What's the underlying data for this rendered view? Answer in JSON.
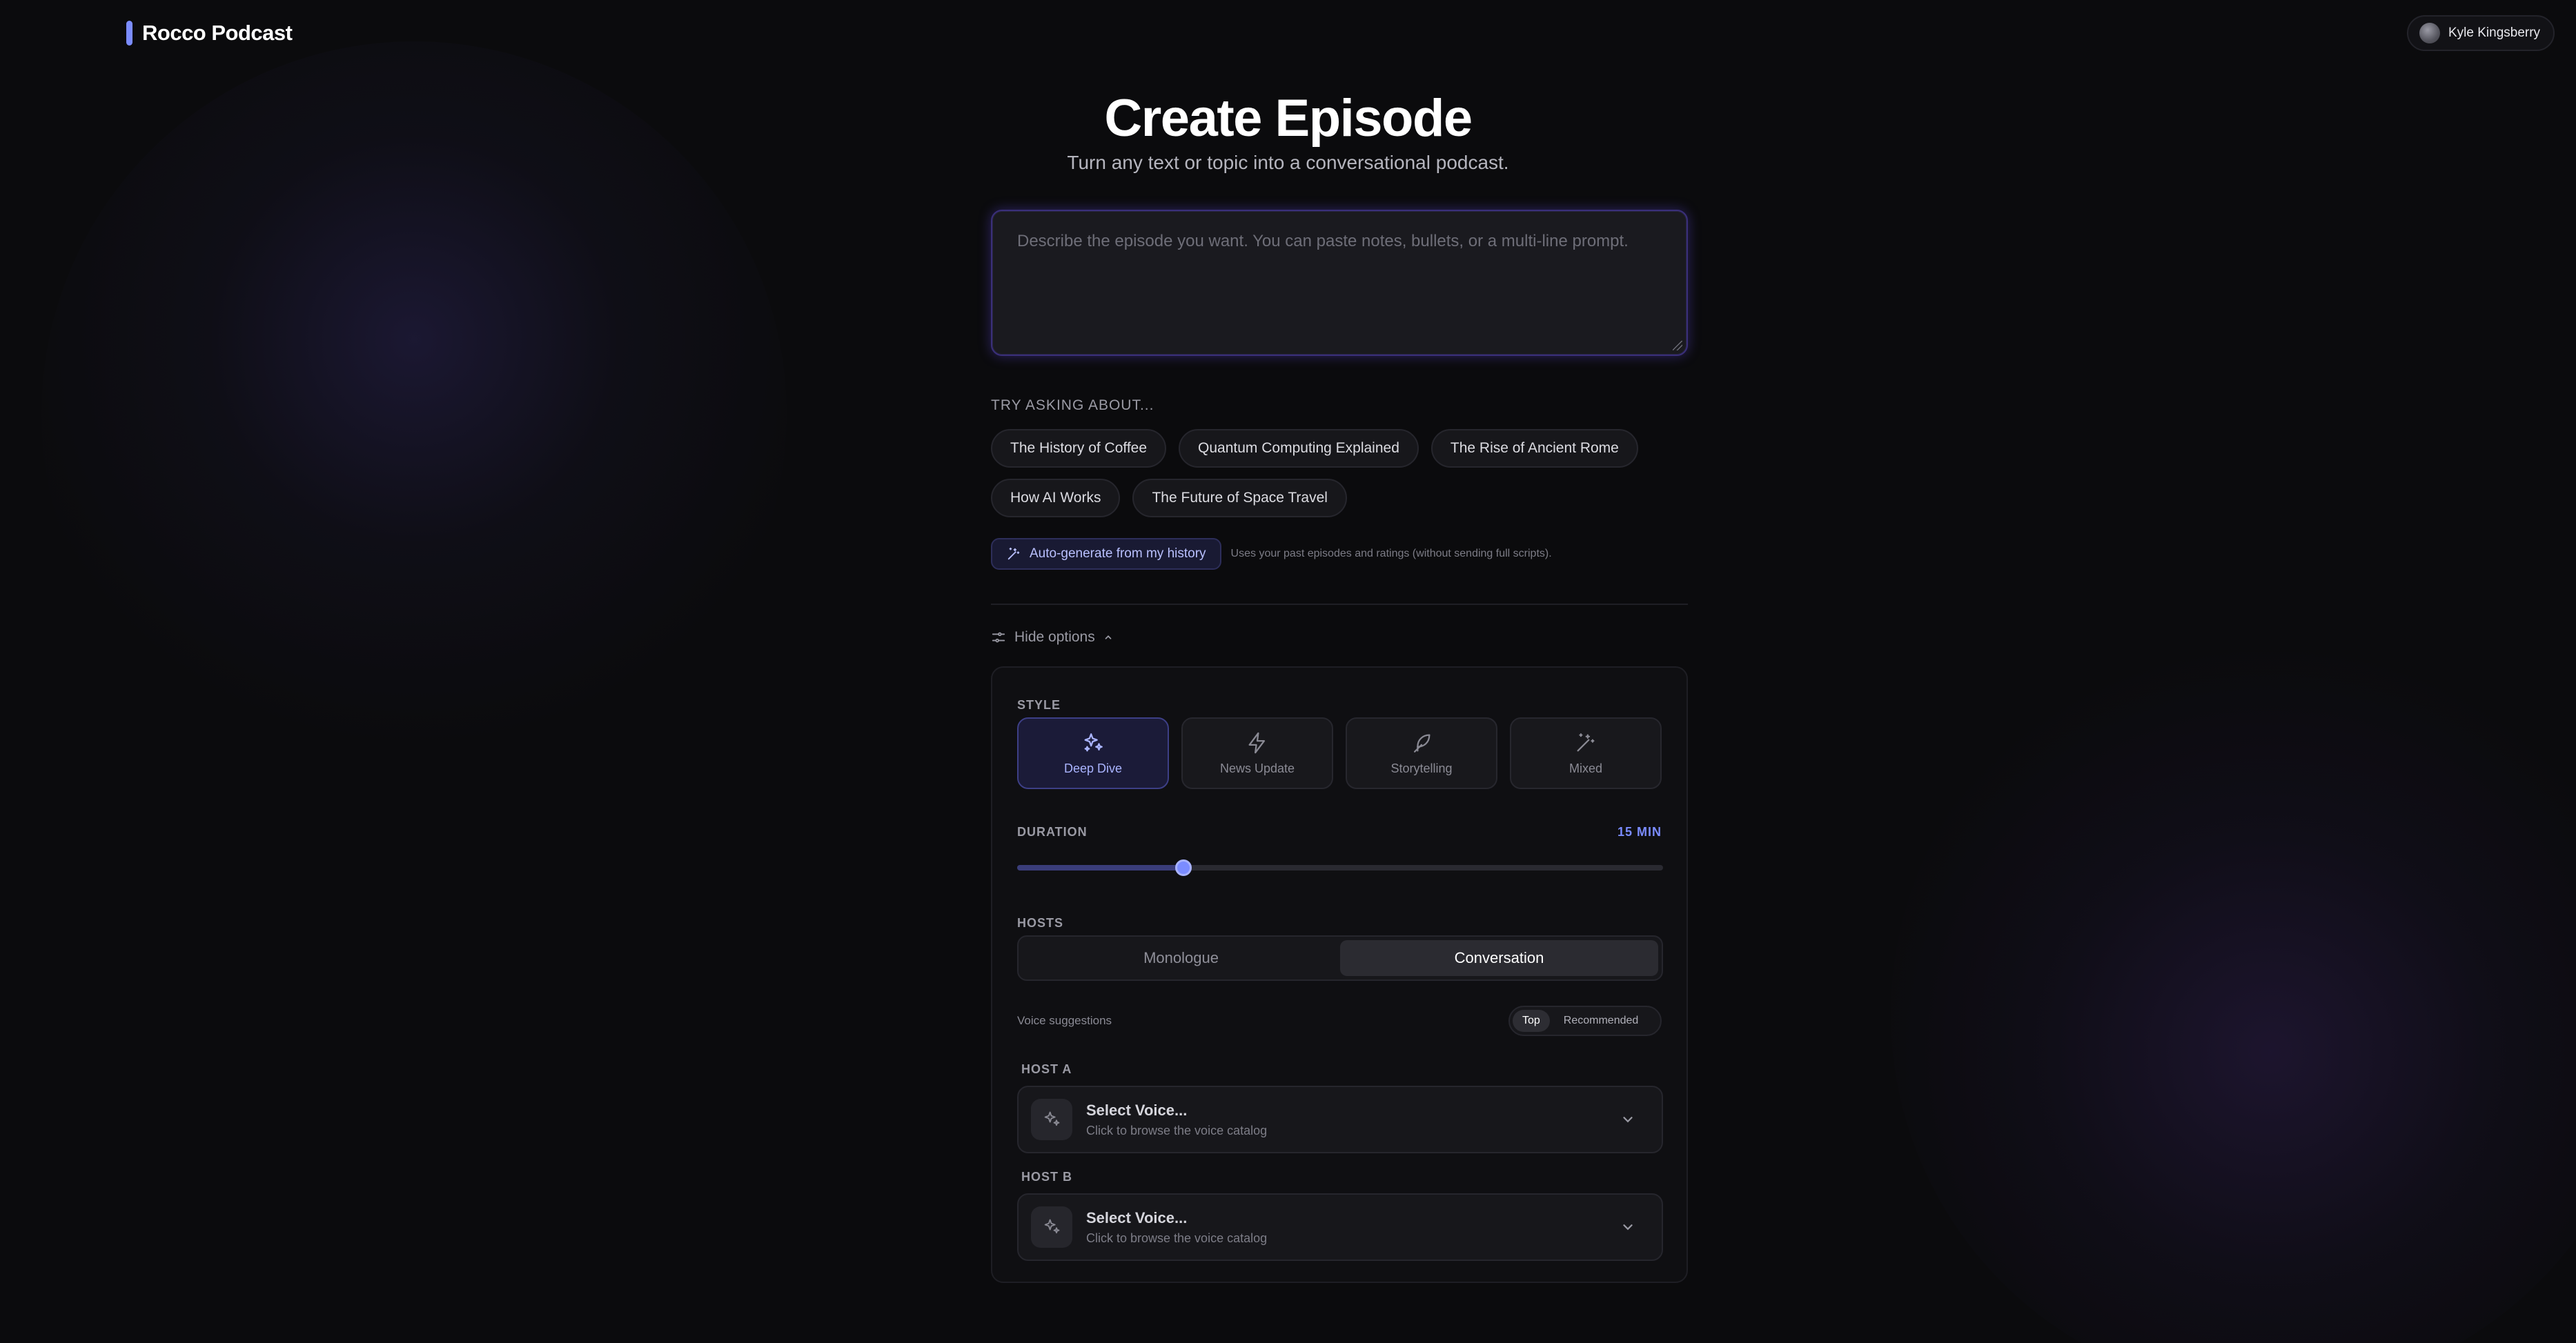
{
  "header": {
    "brand": "Rocco Podcast",
    "user_name": "Kyle Kingsberry"
  },
  "hero": {
    "title": "Create Episode",
    "subtitle": "Turn any text or topic into a conversational podcast."
  },
  "prompt": {
    "placeholder": "Describe the episode you want. You can paste notes, bullets, or a multi-line prompt.",
    "value": ""
  },
  "suggestions": {
    "label": "TRY ASKING ABOUT...",
    "items": [
      "The History of Coffee",
      "Quantum Computing Explained",
      "The Rise of Ancient Rome",
      "How AI Works",
      "The Future of Space Travel"
    ]
  },
  "autogen": {
    "button": "Auto-generate from my history",
    "note": "Uses your past episodes and ratings (without sending full scripts)."
  },
  "options": {
    "toggle_label": "Hide options",
    "style": {
      "label": "STYLE",
      "items": [
        "Deep Dive",
        "News Update",
        "Storytelling",
        "Mixed"
      ],
      "selected": "Deep Dive"
    },
    "duration": {
      "label": "DURATION",
      "value_label": "15 MIN",
      "fraction": 0.257
    },
    "hosts": {
      "label": "HOSTS",
      "modes": [
        "Monologue",
        "Conversation"
      ],
      "selected": "Conversation"
    },
    "voice_suggestions": {
      "label": "Voice suggestions",
      "modes": [
        "Top",
        "Recommended"
      ],
      "selected": "Top"
    },
    "host_a": {
      "label": "HOST A",
      "title": "Select Voice...",
      "subtitle": "Click to browse the voice catalog"
    },
    "host_b": {
      "label": "HOST B",
      "title": "Select Voice...",
      "subtitle": "Click to browse the voice catalog"
    }
  },
  "colors": {
    "accent": "#7b8cff",
    "background": "#0b0b0d",
    "panel": "#0f0f12"
  }
}
